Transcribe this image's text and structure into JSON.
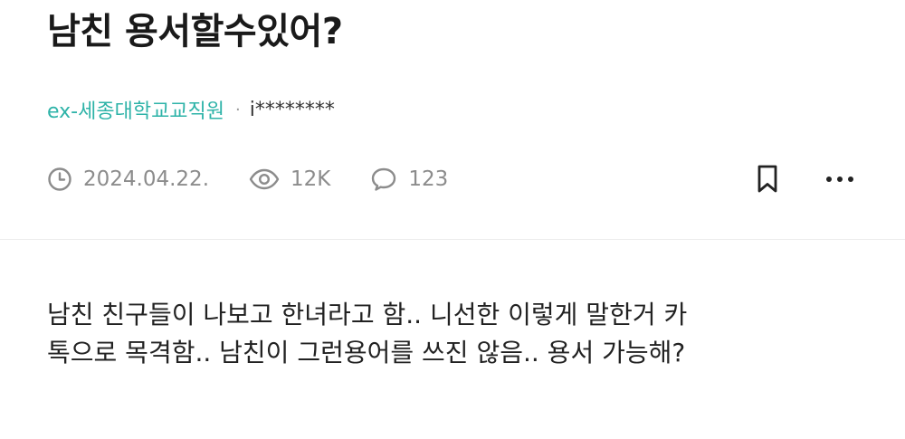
{
  "post": {
    "title": "남친 용서할수있어?",
    "author": {
      "company": "ex-세종대학교교직원",
      "separator": "·",
      "nickname": "i********"
    },
    "meta": {
      "date": "2024.04.22.",
      "views": "12K",
      "comments": "123"
    },
    "actions": {
      "bookmark_icon": "bookmark-icon",
      "more_icon": "more-horizontal-icon"
    },
    "body_lines": [
      "남친 친구들이 나보고 한녀라고 함.. 니선한 이렇게 말한거 카",
      "톡으로 목격함.. 남친이 그런용어를 쓰진 않음.. 용서 가능해?"
    ]
  },
  "colors": {
    "company_text": "#2eb3a8",
    "meta_text": "#8c8c8c",
    "title_text": "#1a1a1a",
    "divider": "#ececec"
  }
}
